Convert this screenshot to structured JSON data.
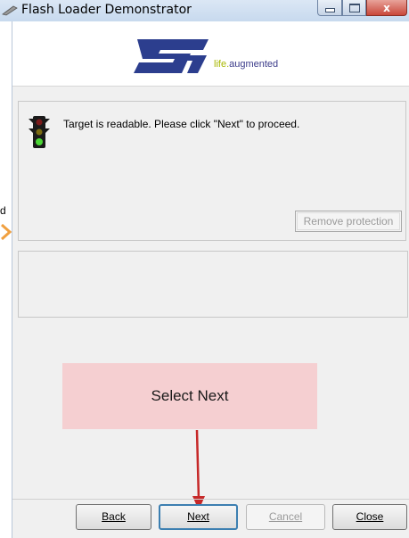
{
  "window": {
    "title": "Flash Loader Demonstrator",
    "close_glyph": "x"
  },
  "logo": {
    "name": "st-logo",
    "tagline_life": "life",
    "tagline_dot": ".",
    "tagline_aug": "augmented",
    "colors": {
      "logo_blue": "#2c3e8e",
      "tagline_green": "#a7b700"
    }
  },
  "status": {
    "icon": "traffic-light-icon",
    "message": "Target is readable. Please click \"Next\" to proceed.",
    "remove_protection_label": "Remove protection"
  },
  "annotation": {
    "label": "Select Next",
    "box_color": "#f5cfd1",
    "arrow_color": "#c62828",
    "edge_text": "d"
  },
  "buttons": {
    "back": "Back",
    "next": "Next",
    "cancel": "Cancel",
    "close": "Close"
  }
}
